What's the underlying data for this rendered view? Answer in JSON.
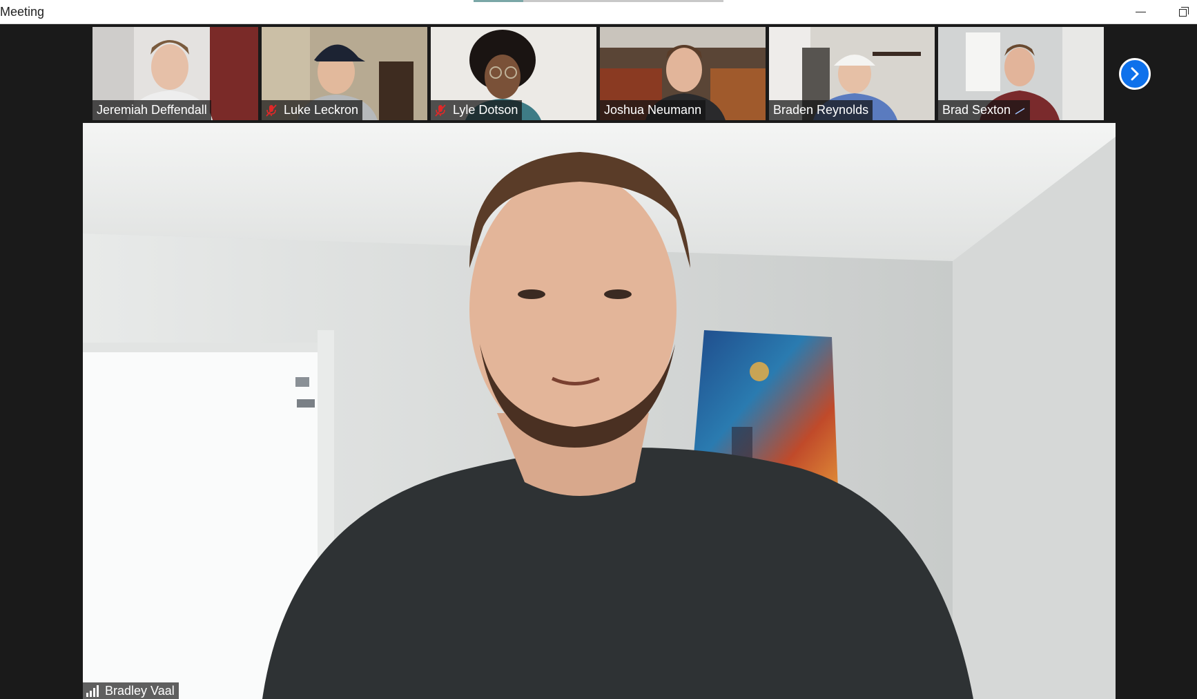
{
  "window": {
    "title": "Meeting",
    "controls": {
      "minimize_icon": "minimize-icon",
      "restore_icon": "restore-icon"
    }
  },
  "gallery": {
    "participants": [
      {
        "name": "Jeremiah Deffendall",
        "muted": false,
        "bg": "#8a6a5c"
      },
      {
        "name": "Luke Leckron",
        "muted": true,
        "bg": "#a39785"
      },
      {
        "name": "Lyle Dotson",
        "muted": true,
        "bg": "#e9e9e6"
      },
      {
        "name": "Joshua Neumann",
        "muted": false,
        "bg": "#7a5a42"
      },
      {
        "name": "Braden Reynolds",
        "muted": false,
        "bg": "#b9b6b0"
      },
      {
        "name": "Brad Sexton",
        "muted": false,
        "bg": "#cfd2d2"
      }
    ],
    "next_icon": "chevron-right-icon"
  },
  "active_speaker": {
    "name": "Bradley Vaal",
    "signal_icon": "signal-strength-icon"
  },
  "colors": {
    "accent": "#0e71eb",
    "mute": "#e02828",
    "background": "#1a1a1a"
  }
}
